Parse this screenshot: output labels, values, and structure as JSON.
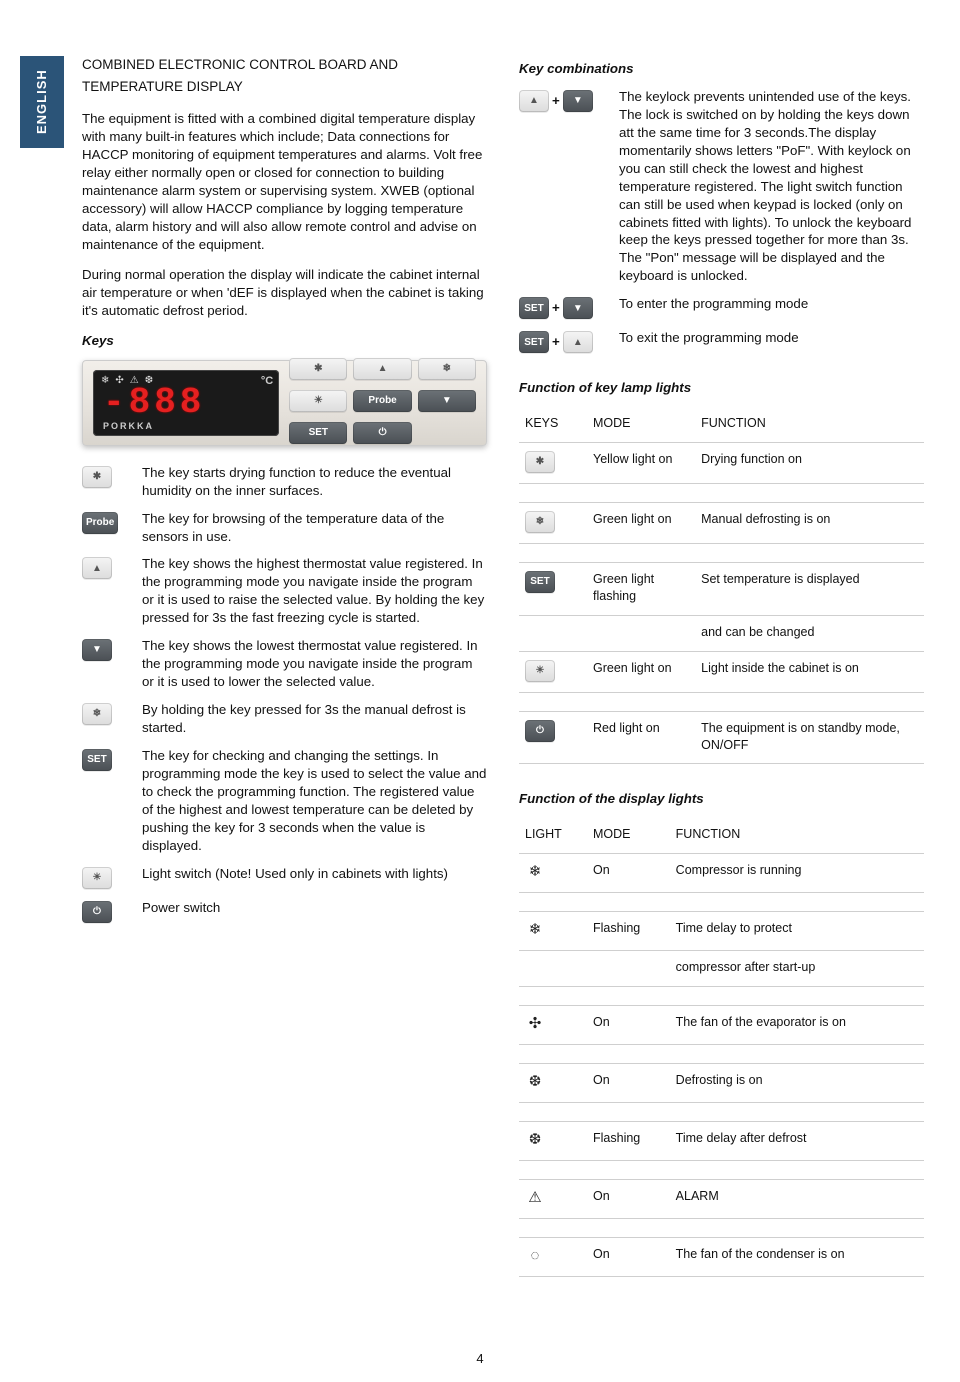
{
  "sidebar": {
    "language_label": "ENGLISH"
  },
  "page_number": "4",
  "left": {
    "title_1": "COMBINED ELECTRONIC CONTROL BOARD AND",
    "title_2": "TEMPERATURE DISPLAY",
    "p1": "The equipment is fitted with a combined digital temperature display with many built-in features which include; Data connections for HACCP monitoring of equipment temperatures and alarms. Volt free relay either normally open or closed for connection to building maintenance alarm system or supervising system. XWEB (optional accessory) will allow HACCP compliance by logging temperature data, alarm history and will also allow remote control and advise on maintenance of the equipment.",
    "p2": "During normal operation the display will indicate the cabinet internal air temperature or when 'dEF is displayed when the cabinet is taking it's automatic defrost period.",
    "keys_heading": "Keys",
    "display_brand": "PORKKA",
    "display_digits": "-888",
    "keys": [
      {
        "icon_type": "light",
        "icon_text": "✱",
        "semantic": "key-dry",
        "desc": "The key starts drying function to reduce the eventual humidity on the inner surfaces."
      },
      {
        "icon_type": "dark",
        "icon_text": "Probe",
        "semantic": "key-probe",
        "desc": "The key for browsing of the temperature data of the sensors in use."
      },
      {
        "icon_type": "light",
        "icon_text": "▲",
        "semantic": "key-up",
        "desc": "The key shows the highest thermostat value registered. In the programming mode you navigate inside the program or it is used to raise the selected value. By holding the key pressed for 3s the fast freezing cycle is started."
      },
      {
        "icon_type": "dark",
        "icon_text": "▼",
        "semantic": "key-down",
        "desc": "The key shows the lowest thermostat value registered. In the programming mode you navigate inside the program or it is used to lower the selected value."
      },
      {
        "icon_type": "light",
        "icon_text": "❄",
        "semantic": "key-defrost",
        "desc": "By holding the key pressed for 3s the manual defrost is started."
      },
      {
        "icon_type": "dark",
        "icon_text": "SET",
        "semantic": "key-set",
        "desc": "The key for checking and changing the settings. In programming mode the key is used to select the value and to check the programming function. The registered value of the highest and lowest temperature can be deleted by pushing the key for 3 seconds when the value is displayed."
      },
      {
        "icon_type": "light",
        "icon_text": "☀",
        "semantic": "key-light",
        "desc": "Light switch (Note!  Used only in cabinets with lights)"
      },
      {
        "icon_type": "dark",
        "icon_text": "⏻",
        "semantic": "key-power",
        "desc": "Power switch"
      }
    ]
  },
  "right": {
    "comb_heading": "Key combinations",
    "combos": [
      {
        "left_icon": "▲",
        "left_type": "light",
        "right_icon": "▼",
        "right_type": "dark",
        "semantic": "combo-lock",
        "desc": "The keylock prevents unintended use of the keys. The lock is switched on by holding the keys down att the same time for 3 seconds.The display momentarily shows letters \"PoF\". With keylock on you can still check the lowest and highest temperature registered. The light switch function can still be used when keypad is locked (only on cabinets fitted with lights). To unlock the keyboard keep the keys pressed together for more than 3s. The \"Pon\" message will be displayed and the keyboard is unlocked."
      },
      {
        "left_icon": "SET",
        "left_type": "dark",
        "right_icon": "▼",
        "right_type": "dark",
        "semantic": "combo-enter-prog",
        "desc": "To enter the programming mode"
      },
      {
        "left_icon": "SET",
        "left_type": "dark",
        "right_icon": "▲",
        "right_type": "light",
        "semantic": "combo-exit-prog",
        "desc": "To exit the programming mode"
      }
    ],
    "keylamp_heading": "Function of key lamp lights",
    "keylamp_headers": {
      "c1": "KEYS",
      "c2": "MODE",
      "c3": "FUNCTION"
    },
    "keylamp_rows": [
      {
        "icon": "✱",
        "btn_type": "light",
        "mode": "Yellow light on",
        "func": "Drying function on"
      },
      {
        "icon": "",
        "mode": "",
        "func": ""
      },
      {
        "icon": "❄",
        "btn_type": "light",
        "mode": "Green light on",
        "func": "Manual defrosting is on"
      },
      {
        "icon": "",
        "mode": "",
        "func": ""
      },
      {
        "icon": "SET",
        "btn_type": "dark",
        "mode": "Green light flashing",
        "func": "Set temperature is displayed"
      },
      {
        "icon": "",
        "mode": "",
        "func": "and can be changed"
      },
      {
        "icon": "☀",
        "btn_type": "light",
        "mode": "Green light on",
        "func": "Light inside the cabinet is on"
      },
      {
        "icon": "",
        "mode": "",
        "func": ""
      },
      {
        "icon": "⏻",
        "btn_type": "dark",
        "mode": "Red light on",
        "func": "The equipment is on standby mode, ON/OFF"
      }
    ],
    "display_heading": "Function of the display lights",
    "display_headers": {
      "c1": "LIGHT",
      "c2": "MODE",
      "c3": "FUNCTION"
    },
    "display_rows": [
      {
        "icon": "❄",
        "mode": "On",
        "func": "Compressor is running"
      },
      {
        "icon": "",
        "mode": "",
        "func": ""
      },
      {
        "icon": "❄",
        "mode": "Flashing",
        "func": "Time delay to protect"
      },
      {
        "icon": "",
        "mode": "",
        "func": "compressor after start-up"
      },
      {
        "icon": "",
        "mode": "",
        "func": ""
      },
      {
        "icon": "✣",
        "mode": "On",
        "func": "The fan of the evaporator is on"
      },
      {
        "icon": "",
        "mode": "",
        "func": ""
      },
      {
        "icon": "❆",
        "mode": "On",
        "func": "Defrosting is on"
      },
      {
        "icon": "",
        "mode": "",
        "func": ""
      },
      {
        "icon": "❆",
        "mode": "Flashing",
        "func": "Time delay after defrost"
      },
      {
        "icon": "",
        "mode": "",
        "func": ""
      },
      {
        "icon": "⚠",
        "mode": "On",
        "func": "ALARM"
      },
      {
        "icon": "",
        "mode": "",
        "func": ""
      },
      {
        "icon": "◌",
        "mode": "On",
        "func": "The fan of the condenser is on"
      }
    ]
  }
}
